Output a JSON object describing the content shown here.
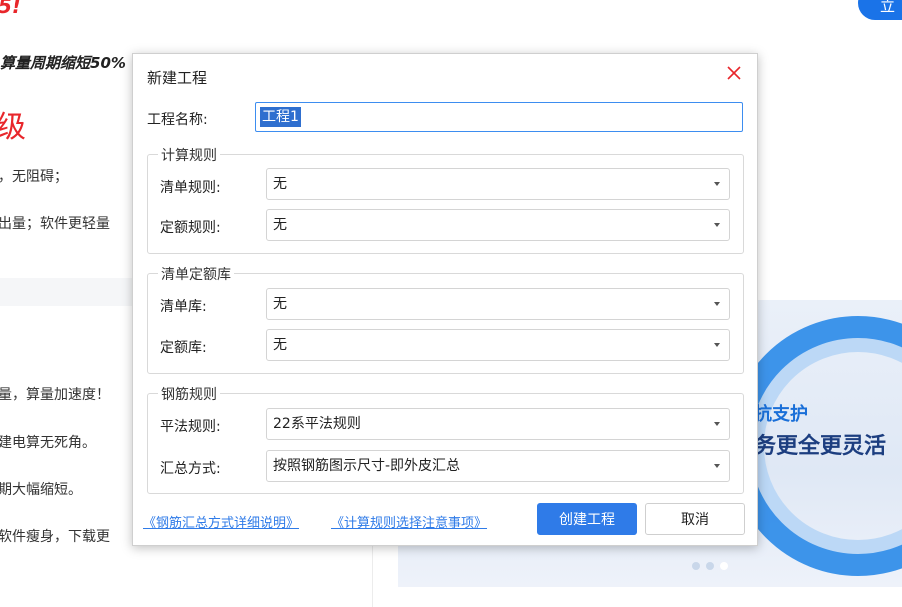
{
  "background": {
    "red_heading_tail": "5!",
    "italic_line": "算量周期缩短50%",
    "red_big": "级",
    "lines": [
      "，无阻碍；",
      "出量；软件更轻量",
      "量，算量加速度！",
      "建电算无死角。",
      "期大幅缩短。",
      "软件瘦身，下载更"
    ],
    "top_button": "立",
    "banner": {
      "line1": "抗支护",
      "line2": "务更全更灵活"
    }
  },
  "dialog": {
    "title": "新建工程",
    "close_icon": "close-icon",
    "project_name_label": "工程名称:",
    "project_name_value": "工程1",
    "groups": {
      "calc_rules": {
        "title": "计算规则",
        "bill_rule_label": "清单规则:",
        "bill_rule_value": "无",
        "quota_rule_label": "定额规则:",
        "quota_rule_value": "无"
      },
      "library": {
        "title": "清单定额库",
        "bill_lib_label": "清单库:",
        "bill_lib_value": "无",
        "quota_lib_label": "定额库:",
        "quota_lib_value": "无"
      },
      "rebar": {
        "title": "钢筋规则",
        "flat_rule_label": "平法规则:",
        "flat_rule_value": "22系平法规则",
        "summary_label": "汇总方式:",
        "summary_value": "按照钢筋图示尺寸-即外皮汇总"
      }
    },
    "links": {
      "summary_help": "《钢筋汇总方式详细说明》",
      "rule_notes": "《计算规则选择注意事项》"
    },
    "buttons": {
      "create": "创建工程",
      "cancel": "取消"
    },
    "accent_color": "#2f7be8",
    "close_color": "#e8262b"
  }
}
